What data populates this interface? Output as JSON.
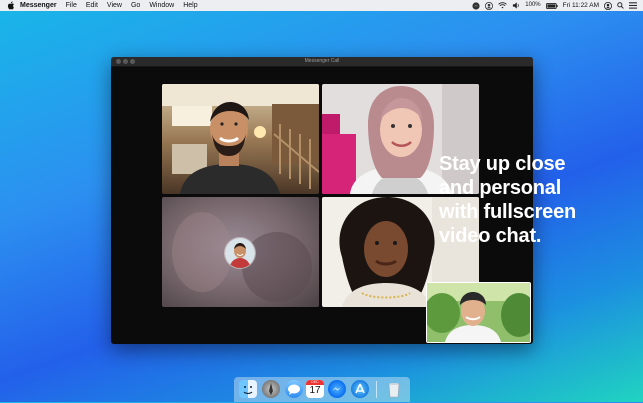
{
  "menubar": {
    "items": [
      "Messenger",
      "File",
      "Edit",
      "View",
      "Go",
      "Window",
      "Help"
    ],
    "battery": "100%",
    "clock": "Fri 11:22 AM"
  },
  "window": {
    "title": "Messenger Call"
  },
  "tagline": "Stay up close\nand personal\nwith fullscreen\nvideo chat.",
  "dock": {
    "icons": [
      "finder-icon",
      "launchpad-icon",
      "messages-icon",
      "calendar-icon",
      "messenger-icon",
      "app-store-icon",
      "trash-icon"
    ],
    "calendar_month": "DEC",
    "calendar_day": "17"
  },
  "colors": {
    "background_gradient": [
      "#18b7e8",
      "#2360ea",
      "#20d4c0"
    ],
    "window_bg": "#0b0b0b",
    "messenger_blue": "#0a84ff"
  }
}
